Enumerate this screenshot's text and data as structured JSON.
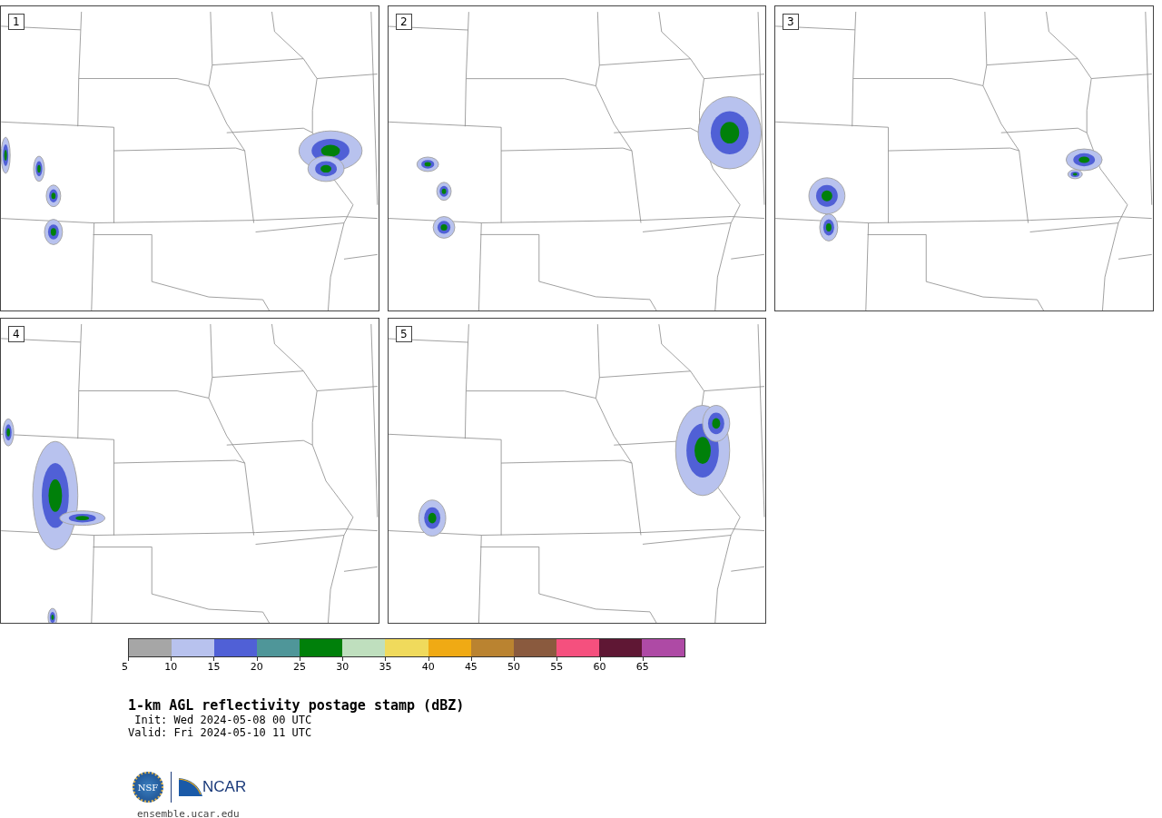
{
  "panels": [
    {
      "label": "1"
    },
    {
      "label": "2"
    },
    {
      "label": "3"
    },
    {
      "label": "4"
    },
    {
      "label": "5"
    }
  ],
  "colorbar": {
    "bins": [
      {
        "color": "#a6a6a6"
      },
      {
        "color": "#b8c2ee"
      },
      {
        "color": "#5060d6"
      },
      {
        "color": "#4f9699"
      },
      {
        "color": "#00800a"
      },
      {
        "color": "#bfdfbe"
      },
      {
        "color": "#f0da5c"
      },
      {
        "color": "#f0aa14"
      },
      {
        "color": "#ba8330"
      },
      {
        "color": "#8a5a3e"
      },
      {
        "color": "#f5507e"
      },
      {
        "color": "#5f1734"
      },
      {
        "color": "#ae4aa5"
      }
    ],
    "ticks": [
      "5",
      "10",
      "15",
      "20",
      "25",
      "30",
      "35",
      "40",
      "45",
      "50",
      "55",
      "60",
      "65"
    ]
  },
  "title": "1-km AGL reflectivity postage stamp (dBZ)",
  "init": " Init: Wed 2024-05-08 00 UTC",
  "valid": "Valid: Fri 2024-05-10 11 UTC",
  "logos": {
    "nsf": "NSF",
    "ncar": "NCAR"
  },
  "url": "ensemble.ucar.edu"
}
